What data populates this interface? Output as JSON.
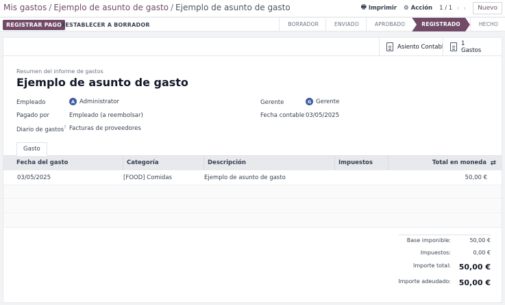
{
  "breadcrumb": {
    "parts": [
      "Mis gastos",
      "Ejemplo de asunto de gasto",
      "Ejemplo de asunto de gasto"
    ]
  },
  "topbar": {
    "print_label": "Imprimir",
    "action_label": "Acción",
    "pager": "1 / 1",
    "new_label": "Nuevo"
  },
  "actions": {
    "register_payment": "REGISTRAR PAGO",
    "reset_draft": "RESTABLECER A BORRADOR"
  },
  "stages": [
    {
      "label": "BORRADOR",
      "active": false
    },
    {
      "label": "ENVIADO",
      "active": false
    },
    {
      "label": "APROBADO",
      "active": false
    },
    {
      "label": "REGISTRADO",
      "active": true
    },
    {
      "label": "HECHO",
      "active": false
    }
  ],
  "smart_buttons": {
    "journal_entry": "Asiento Contabl",
    "expenses_count": "1",
    "expenses_label": "Gastos"
  },
  "form": {
    "summary_label": "Resumen del informe de gastos",
    "title": "Ejemplo de asunto de gasto",
    "employee_label": "Empleado",
    "employee_avatar": "A",
    "employee_value": "Administrator",
    "paid_by_label": "Pagado por",
    "paid_by_value": "Empleado (a reembolsar)",
    "journal_label": "Diario de gastos",
    "journal_help": "?",
    "journal_value": "Facturas de proveedores",
    "manager_label": "Gerente",
    "manager_avatar": "G",
    "manager_value": "Gerente",
    "accounting_date_label": "Fecha contable",
    "accounting_date_value": "03/05/2025"
  },
  "tab": {
    "label": "Gasto"
  },
  "table": {
    "headers": [
      "Fecha del gasto",
      "Categoría",
      "Descripción",
      "Impuestos",
      "Total en moneda"
    ],
    "rows": [
      {
        "date": "03/05/2025",
        "category": "[FOOD] Comidas",
        "description": "Ejemplo de asunto de gasto",
        "taxes": "",
        "total": "50,00 €"
      }
    ]
  },
  "totals": {
    "base_label": "Base imponible:",
    "base_value": "50,00 €",
    "tax_label": "Impuestos:",
    "tax_value": "0,00 €",
    "total_label": "Importe total:",
    "total_value": "50,00 €",
    "due_label": "Importe adeudado:",
    "due_value": "50,00 €"
  },
  "colors": {
    "brand": "#714b67",
    "avatar": "#3b5ba5"
  }
}
